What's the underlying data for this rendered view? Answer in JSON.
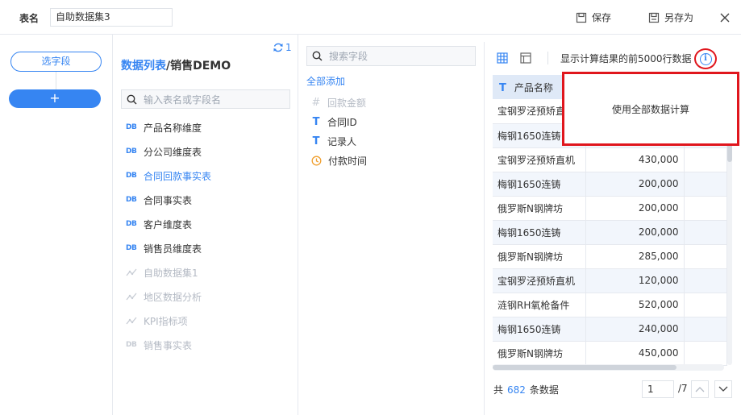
{
  "topbar": {
    "table_name_label": "表名",
    "table_name_value": "自助数据集3",
    "save_label": "保存",
    "save_as_label": "另存为"
  },
  "rail": {
    "select_field_label": "选字段",
    "add_label": "+"
  },
  "data_list": {
    "title_link": "数据列表",
    "title_sep": "/",
    "title_name": "销售DEMO",
    "refresh_count": "1",
    "search_placeholder": "输入表名或字段名",
    "items": [
      {
        "icon": "DB",
        "label": "产品名称维度",
        "state": "normal"
      },
      {
        "icon": "DB",
        "label": "分公司维度表",
        "state": "normal"
      },
      {
        "icon": "DB",
        "label": "合同回款事实表",
        "state": "active"
      },
      {
        "icon": "DB",
        "label": "合同事实表",
        "state": "normal"
      },
      {
        "icon": "DB",
        "label": "客户维度表",
        "state": "normal"
      },
      {
        "icon": "DB",
        "label": "销售员维度表",
        "state": "normal"
      },
      {
        "icon": "self-service-dataset",
        "label": "自助数据集1",
        "state": "disabled"
      },
      {
        "icon": "self-service-dataset",
        "label": "地区数据分析",
        "state": "disabled"
      },
      {
        "icon": "self-service-dataset",
        "label": "KPI指标项",
        "state": "disabled"
      },
      {
        "icon": "DB",
        "label": "销售事实表",
        "state": "disabled"
      }
    ]
  },
  "field_panel": {
    "search_placeholder": "搜索字段",
    "add_all_label": "全部添加",
    "fields": [
      {
        "icon": "#",
        "label": "回款金额",
        "state": "disabled"
      },
      {
        "icon": "T",
        "label": "合同ID",
        "state": "normal"
      },
      {
        "icon": "T",
        "label": "记录人",
        "state": "normal"
      },
      {
        "icon": "clock",
        "label": "付款时间",
        "state": "normal"
      }
    ]
  },
  "preview": {
    "note": "显示计算结果的前5000行数据",
    "column_header": "产品名称",
    "rows": [
      {
        "name": "宝钢罗泾预矫直机",
        "value": ""
      },
      {
        "name": "梅钢1650连铸",
        "value": ""
      },
      {
        "name": "宝钢罗泾预矫直机",
        "value": "430,000"
      },
      {
        "name": "梅钢1650连铸",
        "value": "200,000"
      },
      {
        "name": "俄罗斯N钢牌坊",
        "value": "200,000"
      },
      {
        "name": "梅钢1650连铸",
        "value": "200,000"
      },
      {
        "name": "俄罗斯N钢牌坊",
        "value": "285,000"
      },
      {
        "name": "宝钢罗泾预矫直机",
        "value": "120,000"
      },
      {
        "name": "涟钢RH氧枪备件",
        "value": "520,000"
      },
      {
        "name": "梅钢1650连铸",
        "value": "240,000"
      },
      {
        "name": "俄罗斯N钢牌坊",
        "value": "450,000"
      }
    ],
    "footer_prefix": "共",
    "row_count": "682",
    "footer_suffix": "条数据",
    "page_value": "1",
    "page_total": "/7"
  },
  "popup": {
    "label": "使用全部数据计算"
  },
  "colors": {
    "accent": "#3685f2",
    "highlight_red": "#e0161d",
    "header_bg": "#dfe9f7",
    "row_alt_bg": "#f2f6fc"
  }
}
